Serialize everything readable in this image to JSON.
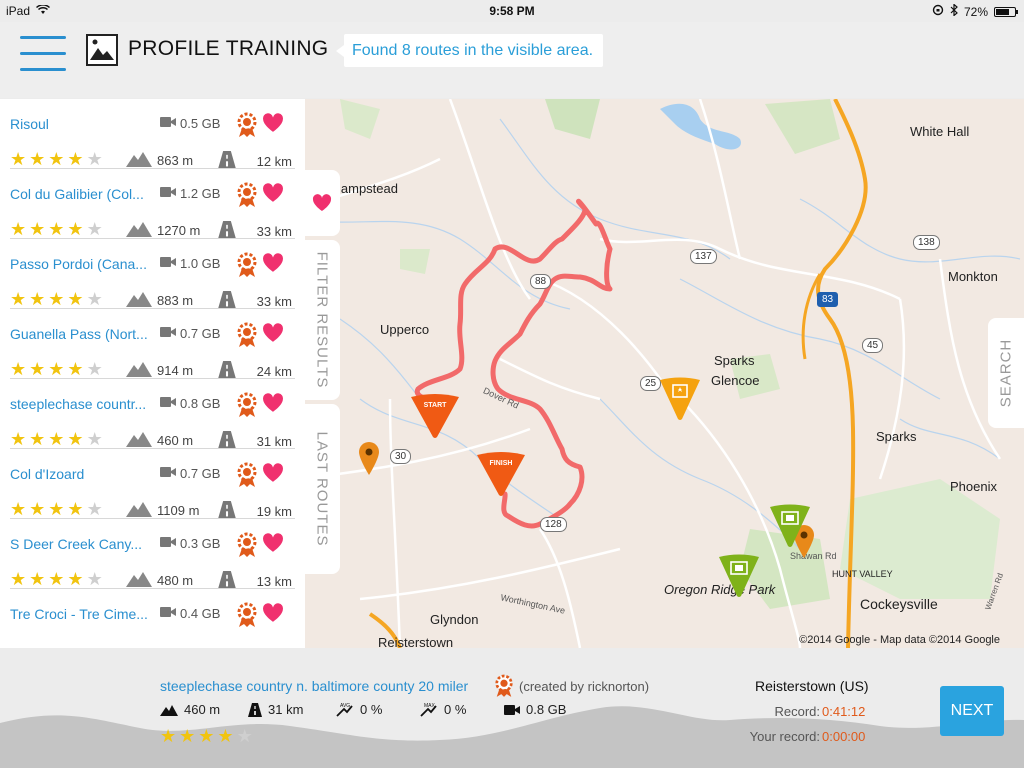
{
  "status": {
    "device": "iPad",
    "time": "9:58 PM",
    "battery": "72%",
    "battery_level": 0.72
  },
  "header": {
    "title": "PROFILE TRAINING",
    "found_text": "Found 8 routes in the visible area."
  },
  "routes": [
    {
      "name": "Risoul",
      "size": "0.5 GB",
      "stars": 4,
      "elevation": "863 m",
      "distance": "12 km"
    },
    {
      "name": "Col du Galibier (Col...",
      "size": "1.2 GB",
      "stars": 4,
      "elevation": "1270 m",
      "distance": "33 km"
    },
    {
      "name": "Passo Pordoi (Cana...",
      "size": "1.0 GB",
      "stars": 4,
      "elevation": "883 m",
      "distance": "33 km"
    },
    {
      "name": "Guanella Pass (Nort...",
      "size": "0.7 GB",
      "stars": 4,
      "elevation": "914 m",
      "distance": "24 km"
    },
    {
      "name": "steeplechase countr...",
      "size": "0.8 GB",
      "stars": 4,
      "elevation": "460 m",
      "distance": "31 km"
    },
    {
      "name": "Col d'Izoard",
      "size": "0.7 GB",
      "stars": 4,
      "elevation": "1109 m",
      "distance": "19 km"
    },
    {
      "name": "S Deer Creek Cany...",
      "size": "0.3 GB",
      "stars": 4,
      "elevation": "480 m",
      "distance": "13 km"
    },
    {
      "name": "Tre Croci - Tre Cime...",
      "size": "0.4 GB",
      "stars": null,
      "elevation": "",
      "distance": ""
    }
  ],
  "tabs": {
    "filter": "FILTER RESULTS",
    "last": "LAST ROUTES",
    "search": "SEARCH"
  },
  "map": {
    "places": [
      {
        "id": "hampstead",
        "label": "lampstead"
      },
      {
        "id": "white-hall",
        "label": "White Hall"
      },
      {
        "id": "monkton",
        "label": "Monkton"
      },
      {
        "id": "upperco",
        "label": "Upperco"
      },
      {
        "id": "sparks-glencoe-1",
        "label": "Sparks"
      },
      {
        "id": "sparks-glencoe-2",
        "label": "Glencoe"
      },
      {
        "id": "sparks",
        "label": "Sparks"
      },
      {
        "id": "phoenix",
        "label": "Phoenix"
      },
      {
        "id": "oregon-ridge",
        "label": "Oregon Ridge Park"
      },
      {
        "id": "hunt-valley",
        "label": "HUNT VALLEY"
      },
      {
        "id": "cockeysville",
        "label": "Cockeysville"
      },
      {
        "id": "glyndon",
        "label": "Glyndon"
      },
      {
        "id": "reisterstown",
        "label": "Reisterstown"
      },
      {
        "id": "worthington",
        "label": "Worthington Ave"
      },
      {
        "id": "dover-rd",
        "label": "Dover Rd"
      },
      {
        "id": "shawan-rd",
        "label": "Shawan Rd"
      },
      {
        "id": "warren-rd",
        "label": "Warren Rd"
      }
    ],
    "shields": [
      "137",
      "138",
      "88",
      "45",
      "25",
      "30",
      "128",
      "83"
    ],
    "markers": {
      "start": "START",
      "finish": "FINISH"
    },
    "copyright": "©2014 Google - Map data ©2014 Google"
  },
  "selected": {
    "title": "steeplechase country n. baltimore county 20 miler",
    "creator": "(created by ricknorton)",
    "elevation": "460 m",
    "distance": "31 km",
    "avg_grade": "0 %",
    "max_grade": "0 %",
    "size": "0.8 GB",
    "stars": 4,
    "location": "Reisterstown (US)",
    "record_label": "Record:",
    "record_value": "0:41:12",
    "your_record_label": "Your record:",
    "your_record_value": "0:00:00",
    "next_label": "NEXT"
  },
  "colors": {
    "accent": "#2a8fcf",
    "route_line": "#f26a6a",
    "marker_orange": "#f05a14",
    "star": "#f1c40f",
    "heart": "#f0306e"
  }
}
